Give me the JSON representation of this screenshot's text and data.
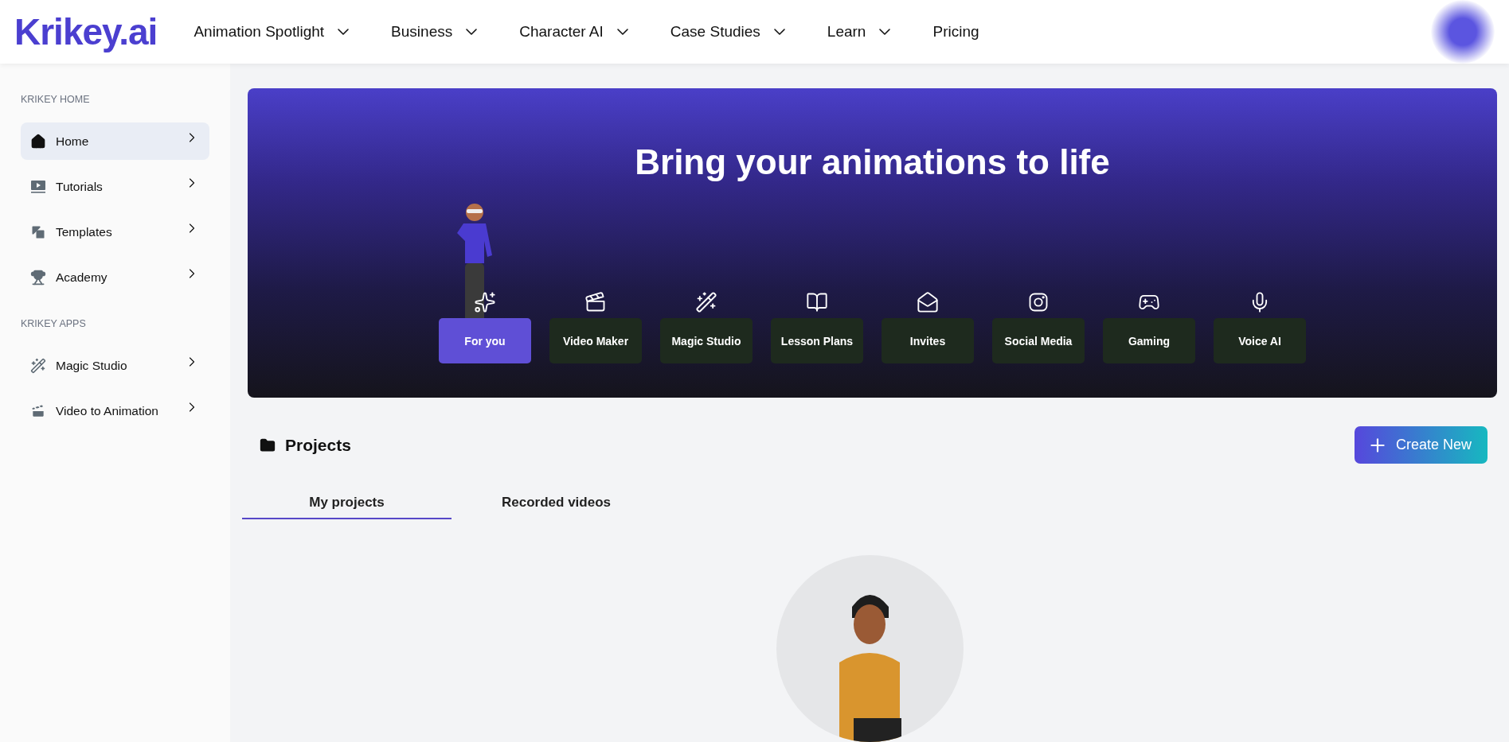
{
  "logo": {
    "text": "Krikey.ai"
  },
  "nav": [
    {
      "label": "Animation Spotlight",
      "kind": "dropdown"
    },
    {
      "label": "Business",
      "kind": "dropdown"
    },
    {
      "label": "Character AI",
      "kind": "dropdown"
    },
    {
      "label": "Case Studies",
      "kind": "dropdown"
    },
    {
      "label": "Learn",
      "kind": "dropdown"
    },
    {
      "label": "Pricing",
      "kind": "link"
    }
  ],
  "sidebar": {
    "sections": [
      {
        "heading": "KRIKEY HOME",
        "items": [
          {
            "label": "Home",
            "kind": "home",
            "selected": true
          },
          {
            "label": "Tutorials",
            "kind": "tutorials",
            "selected": false
          },
          {
            "label": "Templates",
            "kind": "templates",
            "selected": false
          },
          {
            "label": "Academy",
            "kind": "academy",
            "selected": false
          }
        ]
      },
      {
        "heading": "KRIKEY APPS",
        "items": [
          {
            "label": "Magic Studio",
            "kind": "magic",
            "selected": false
          },
          {
            "label": "Video to Animation",
            "kind": "video",
            "selected": false
          }
        ]
      }
    ]
  },
  "banner": {
    "title": "Bring your animations to life",
    "categories": [
      {
        "label": "For you",
        "kind": "sparkles",
        "selected": true
      },
      {
        "label": "Video Maker",
        "kind": "clapper",
        "selected": false
      },
      {
        "label": "Magic Studio",
        "kind": "wand",
        "selected": false
      },
      {
        "label": "Lesson Plans",
        "kind": "book",
        "selected": false
      },
      {
        "label": "Invites",
        "kind": "mail",
        "selected": false
      },
      {
        "label": "Social Media",
        "kind": "camera",
        "selected": false
      },
      {
        "label": "Gaming",
        "kind": "gamepad",
        "selected": false
      },
      {
        "label": "Voice AI",
        "kind": "mic",
        "selected": false
      }
    ]
  },
  "projects": {
    "title": "Projects",
    "create_button": "Create New",
    "tabs": [
      {
        "label": "My projects",
        "selected": true
      },
      {
        "label": "Recorded videos",
        "selected": false
      }
    ]
  }
}
